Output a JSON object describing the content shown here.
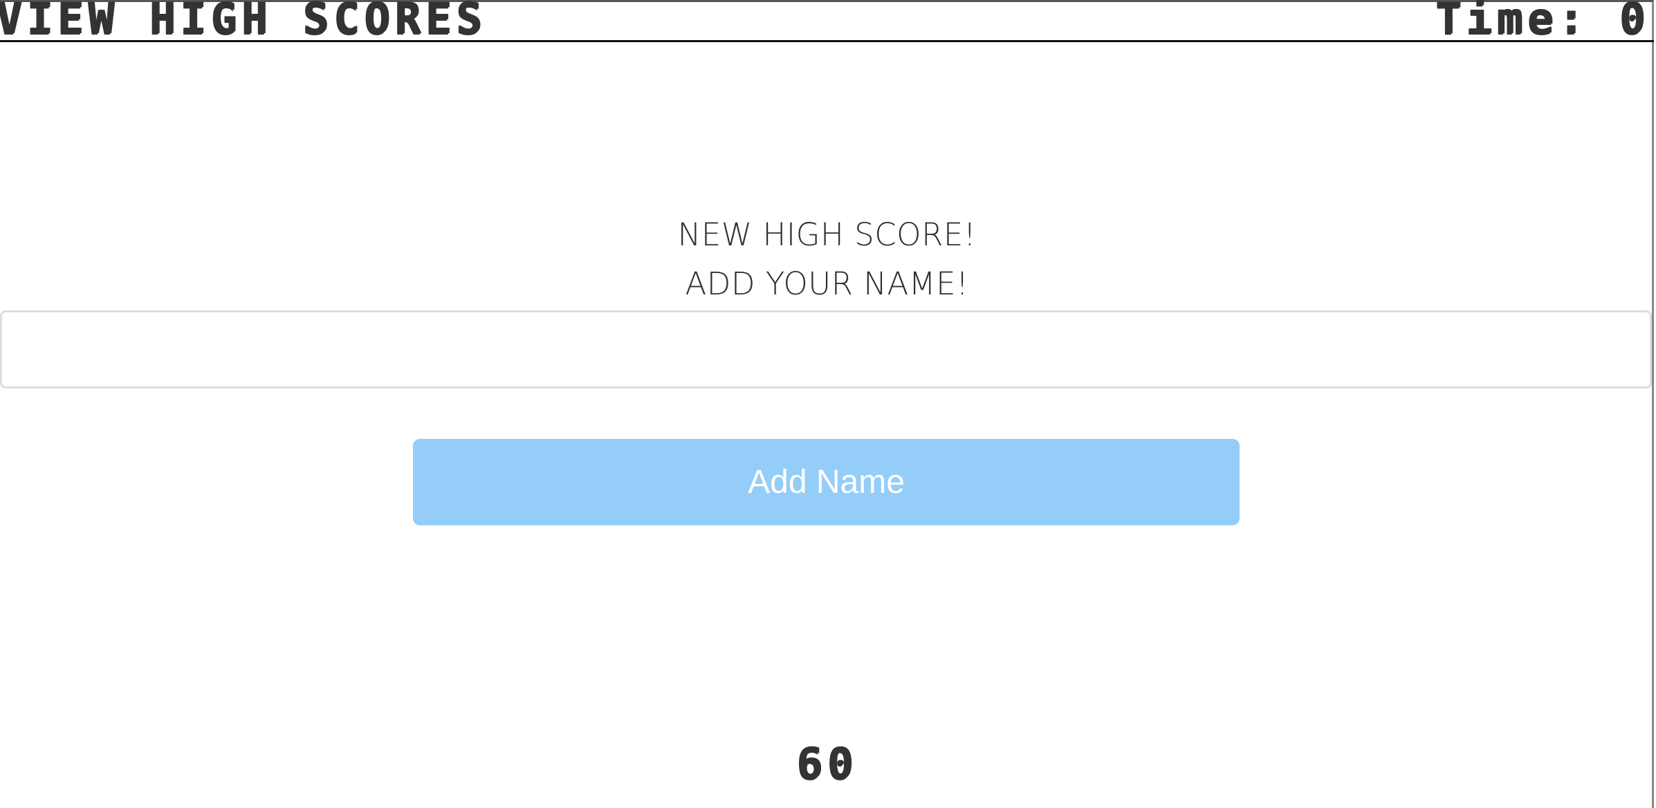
{
  "header": {
    "high_scores_link": "VIEW HIGH SCORES",
    "timer_label": "Time:",
    "timer_value": "0"
  },
  "prompt": {
    "line1": "NEW HIGH SCORE!",
    "line2": "ADD YOUR NAME!"
  },
  "name_input": {
    "value": "",
    "placeholder": ""
  },
  "submit_button": {
    "label": "Add Name"
  },
  "score": {
    "value": "60"
  },
  "colors": {
    "button_background": "#94cdf8",
    "text": "#333333",
    "header_border": "#111111"
  }
}
